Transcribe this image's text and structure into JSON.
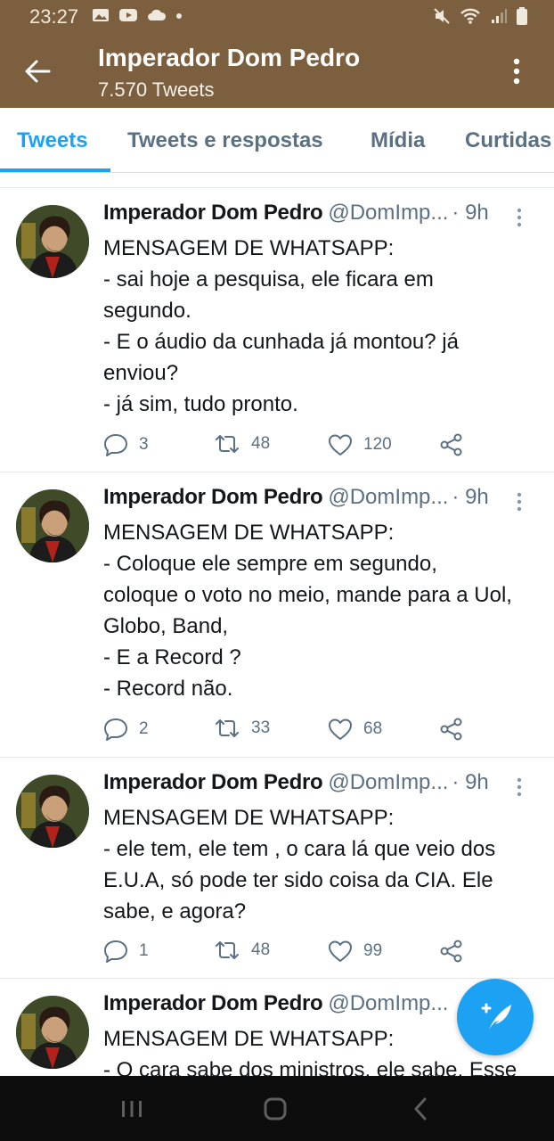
{
  "status_bar": {
    "time": "23:27",
    "left_icons": [
      "gallery-icon",
      "youtube-icon",
      "cloud-icon",
      "dot-icon"
    ],
    "right_icons": [
      "mute-icon",
      "wifi-icon",
      "signal-icon",
      "battery-icon"
    ]
  },
  "header": {
    "title": "Imperador Dom Pedro",
    "subtitle": "7.570 Tweets",
    "background": "#7b5f3f"
  },
  "tabs": [
    {
      "label": "Tweets",
      "active": true
    },
    {
      "label": "Tweets e respostas",
      "active": false
    },
    {
      "label": "Mídia",
      "active": false
    },
    {
      "label": "Curtidas",
      "active": false
    }
  ],
  "accent_color": "#1da1f2",
  "tweets": [
    {
      "author": "Imperador Dom Pedro",
      "handle": "@DomImp...",
      "time": "· 9h",
      "lines": [
        "MENSAGEM DE WHATSAPP:",
        "- sai hoje a pesquisa, ele ficara em",
        "segundo.",
        "- E o áudio da cunhada já montou? já",
        "enviou?",
        "- já sim, tudo pronto."
      ],
      "replies": "3",
      "retweets": "48",
      "likes": "120"
    },
    {
      "author": "Imperador Dom Pedro",
      "handle": "@DomImp...",
      "time": "· 9h",
      "lines": [
        "MENSAGEM DE WHATSAPP:",
        "- Coloque ele sempre em segundo,",
        "coloque o voto no meio, mande para a Uol,",
        "Globo, Band,",
        "- E a Record ?",
        "- Record não."
      ],
      "replies": "2",
      "retweets": "33",
      "likes": "68"
    },
    {
      "author": "Imperador Dom Pedro",
      "handle": "@DomImp...",
      "time": "· 9h",
      "lines": [
        "MENSAGEM DE WHATSAPP:",
        "- ele tem, ele tem , o cara lá que veio dos",
        "E.U.A, só pode ter sido coisa da CIA. Ele",
        "sabe, e agora?"
      ],
      "replies": "1",
      "retweets": "48",
      "likes": "99"
    },
    {
      "author": "Imperador Dom Pedro",
      "handle": "@DomImp...",
      "time": "",
      "lines": [
        "MENSAGEM DE WHATSAPP:",
        "- O cara sabe dos ministros, ele sabe. Esse"
      ],
      "replies": "",
      "retweets": "",
      "likes": ""
    }
  ],
  "fab": {
    "icon": "compose-tweet-icon"
  },
  "nav_bar": {
    "icons": [
      "recents-icon",
      "home-icon",
      "back-nav-icon"
    ]
  }
}
